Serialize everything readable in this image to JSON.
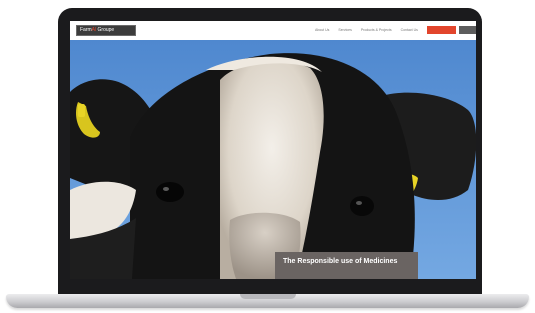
{
  "brand": {
    "name_main": "Farm",
    "name_accent": "Al",
    "name_tail": "Groupe"
  },
  "nav": {
    "items": [
      {
        "label": "About Us"
      },
      {
        "label": "Services"
      },
      {
        "label": "Products & Projects"
      },
      {
        "label": "Contact Us"
      }
    ],
    "cta_primary": "",
    "cta_secondary": ""
  },
  "hero": {
    "caption": "The Responsible use of Medicines"
  },
  "colors": {
    "accent": "#e2452c",
    "sky": "#5e95d6",
    "caption_bg": "#6a6462",
    "ear_tag": "#e8d426"
  },
  "icons": [
    "laptop-device-icon",
    "yellow-ear-tag-icon"
  ]
}
